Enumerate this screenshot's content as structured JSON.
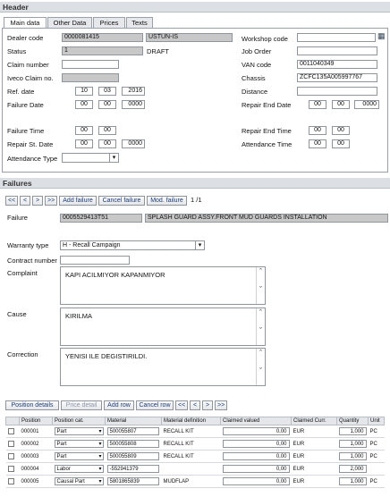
{
  "header": {
    "title": "Header"
  },
  "tabs": [
    "Main data",
    "Other Data",
    "Prices",
    "Texts"
  ],
  "main": {
    "dealer_code_label": "Dealer code",
    "dealer_code": "0000081415",
    "dealer_name": "USTUN-IS",
    "status_label": "Status",
    "status_code": "1",
    "status_text": "DRAFT",
    "claim_number_label": "Claim number",
    "claim_number": "",
    "iveco_claim_label": "Iveco Claim no.",
    "iveco_claim": "",
    "ref_date_label": "Ref. date",
    "ref_date_d": "10",
    "ref_date_m": "03",
    "ref_date_y": "2016",
    "failure_date_label": "Failure Date",
    "failure_date_d": "00",
    "failure_date_m": "00",
    "failure_date_y": "0000",
    "workshop_code_label": "Workshop code",
    "workshop_code": "",
    "job_order_label": "Job Order",
    "job_order": "",
    "van_code_label": "VAN code",
    "van_code": "0011040349",
    "chassis_label": "Chassis",
    "chassis": "ZCFC135A005997767",
    "distance_label": "Distance",
    "distance": "",
    "repair_end_date_label": "Repair End Date",
    "repair_end_d": "00",
    "repair_end_m": "00",
    "repair_end_y": "0000",
    "failure_time_label": "Failure Time",
    "failure_time_h": "00",
    "failure_time_m": "00",
    "repair_st_date_label": "Repair St. Date",
    "repair_st_d": "00",
    "repair_st_m": "00",
    "repair_st_y": "0000",
    "repair_end_time_label": "Repair End Time",
    "repair_end_time_h": "00",
    "repair_end_time_m": "00",
    "attendance_time_label": "Attendance Time",
    "attendance_time_h": "00",
    "attendance_time_m": "00",
    "attendance_type_label": "Attendance Type",
    "attendance_type": ""
  },
  "failures": {
    "title": "Failures",
    "nav": [
      "<<",
      "<",
      ">",
      ">>"
    ],
    "add_failure": "Add failure",
    "cancel_failure": "Cancel failure",
    "mod_failure": "Mod. failure",
    "page": "1 /1",
    "failure_label": "Failure",
    "failure_code": "0005529413T51",
    "failure_desc": "SPLASH GUARD ASSY.FRONT MUD GUARDS INSTALLATION",
    "warranty_type_label": "Warranty type",
    "warranty_type": "H - Recall Campaign",
    "contract_number_label": "Contract number",
    "contract_number": "",
    "complaint_label": "Complaint",
    "complaint": "KAPI ACILMIYOR KAPANMIYOR",
    "cause_label": "Cause",
    "cause": "KIRILMA",
    "correction_label": "Correction",
    "correction": "YENISI ILE DEGISTIRILDI."
  },
  "positions": {
    "details": "Position details",
    "price_detail": "Price detail",
    "add_row": "Add row",
    "cancel_row": "Cancel row",
    "nav": [
      "<<",
      "<",
      ">",
      ">>"
    ],
    "columns": [
      "Position",
      "Position cat.",
      "Material",
      "Material definition",
      "Claimed valued",
      "Claimed Curr.",
      "Quantity",
      "Unit"
    ],
    "rows": [
      {
        "pos": "000001",
        "cat": "Part",
        "mat": "500055807",
        "def": "RECALL KIT",
        "val": "0,00",
        "cur": "EUR",
        "qty": "1,000",
        "unit": "PC"
      },
      {
        "pos": "000002",
        "cat": "Part",
        "mat": "500055808",
        "def": "RECALL KIT",
        "val": "0,00",
        "cur": "EUR",
        "qty": "1,000",
        "unit": "PC"
      },
      {
        "pos": "000003",
        "cat": "Part",
        "mat": "500055809",
        "def": "RECALL KIT",
        "val": "0,00",
        "cur": "EUR",
        "qty": "1,000",
        "unit": "PC"
      },
      {
        "pos": "000004",
        "cat": "Labor",
        "mat": "-552941379",
        "def": "",
        "val": "0,00",
        "cur": "EUR",
        "qty": "2,000",
        "unit": ""
      },
      {
        "pos": "000005",
        "cat": "Causal Part",
        "mat": "5801865839",
        "def": "MUDFLAP",
        "val": "0,00",
        "cur": "EUR",
        "qty": "1,000",
        "unit": "PC"
      }
    ]
  }
}
